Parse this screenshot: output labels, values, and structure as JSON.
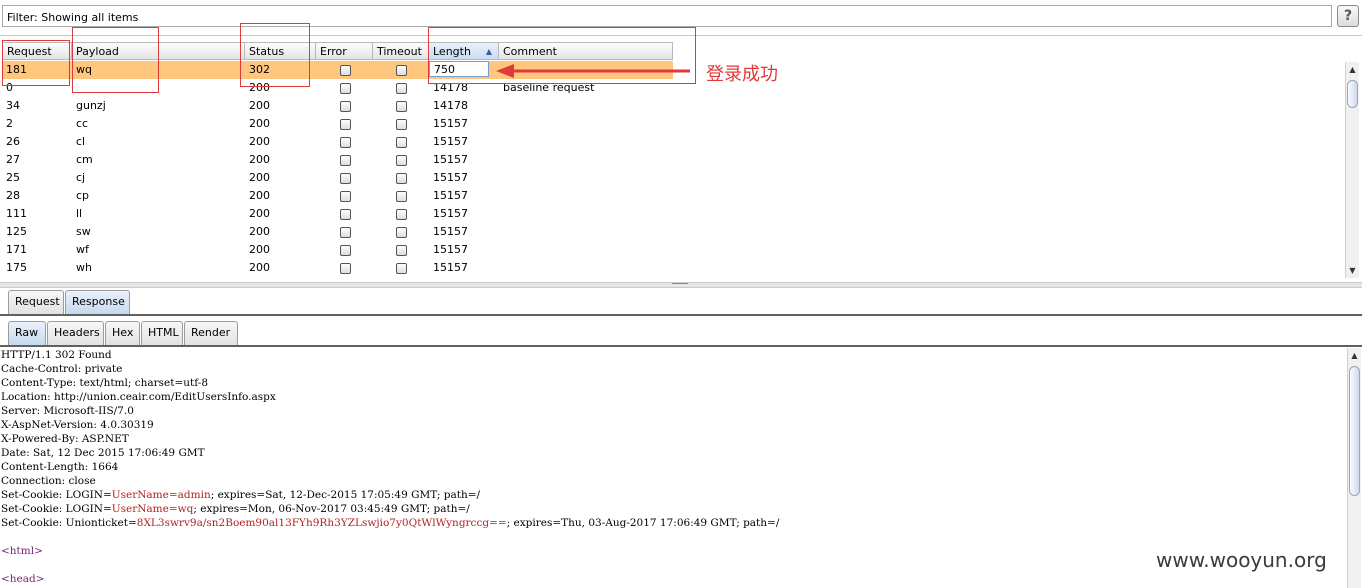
{
  "filter": {
    "text": "Filter: Showing all items",
    "help_label": "?"
  },
  "columns": [
    "Request",
    "Payload",
    "Status",
    "Error",
    "Timeout",
    "Length",
    "Comment"
  ],
  "sorted_column": "Length",
  "rows": [
    {
      "request": "181",
      "payload": "wq",
      "status": "302",
      "error": false,
      "timeout": false,
      "length": "750",
      "comment": "",
      "selected": true
    },
    {
      "request": "0",
      "payload": "",
      "status": "200",
      "error": false,
      "timeout": false,
      "length": "14178",
      "comment": "baseline request"
    },
    {
      "request": "34",
      "payload": "gunzj",
      "status": "200",
      "error": false,
      "timeout": false,
      "length": "14178",
      "comment": ""
    },
    {
      "request": "2",
      "payload": "cc",
      "status": "200",
      "error": false,
      "timeout": false,
      "length": "15157",
      "comment": ""
    },
    {
      "request": "26",
      "payload": "cl",
      "status": "200",
      "error": false,
      "timeout": false,
      "length": "15157",
      "comment": ""
    },
    {
      "request": "27",
      "payload": "cm",
      "status": "200",
      "error": false,
      "timeout": false,
      "length": "15157",
      "comment": ""
    },
    {
      "request": "25",
      "payload": "cj",
      "status": "200",
      "error": false,
      "timeout": false,
      "length": "15157",
      "comment": ""
    },
    {
      "request": "28",
      "payload": "cp",
      "status": "200",
      "error": false,
      "timeout": false,
      "length": "15157",
      "comment": ""
    },
    {
      "request": "111",
      "payload": "ll",
      "status": "200",
      "error": false,
      "timeout": false,
      "length": "15157",
      "comment": ""
    },
    {
      "request": "125",
      "payload": "sw",
      "status": "200",
      "error": false,
      "timeout": false,
      "length": "15157",
      "comment": ""
    },
    {
      "request": "171",
      "payload": "wf",
      "status": "200",
      "error": false,
      "timeout": false,
      "length": "15157",
      "comment": ""
    },
    {
      "request": "175",
      "payload": "wh",
      "status": "200",
      "error": false,
      "timeout": false,
      "length": "15157",
      "comment": ""
    }
  ],
  "annotation": {
    "text": "登录成功"
  },
  "outer_tabs": {
    "items": [
      "Request",
      "Response"
    ],
    "active": "Response"
  },
  "inner_tabs": {
    "items": [
      "Raw",
      "Headers",
      "Hex",
      "HTML",
      "Render"
    ],
    "active": "Raw"
  },
  "response_lines": [
    [
      {
        "t": "HTTP/1.1 302 Found"
      }
    ],
    [
      {
        "t": "Cache-Control: private"
      }
    ],
    [
      {
        "t": "Content-Type: text/html; charset=utf-8"
      }
    ],
    [
      {
        "t": "Location: http://union.ceair.com/EditUsersInfo.aspx"
      }
    ],
    [
      {
        "t": "Server: Microsoft-IIS/7.0"
      }
    ],
    [
      {
        "t": "X-AspNet-Version: 4.0.30319"
      }
    ],
    [
      {
        "t": "X-Powered-By: ASP.NET"
      }
    ],
    [
      {
        "t": "Date: Sat, 12 Dec 2015 17:06:49 GMT"
      }
    ],
    [
      {
        "t": "Content-Length: 1664"
      }
    ],
    [
      {
        "t": "Connection: close"
      }
    ],
    [
      {
        "t": "Set-Cookie: LOGIN="
      },
      {
        "t": "UserName=admin",
        "c": "ck"
      },
      {
        "t": "; expires=Sat, 12-Dec-2015 17:05:49 GMT; path=/"
      }
    ],
    [
      {
        "t": "Set-Cookie: LOGIN="
      },
      {
        "t": "UserName=wq",
        "c": "ck"
      },
      {
        "t": "; expires=Mon, 06-Nov-2017 03:45:49 GMT; path=/"
      }
    ],
    [
      {
        "t": "Set-Cookie: Unionticket="
      },
      {
        "t": "8XL3swrv9a/sn2Boem90al13FYh9Rh3YZLswjio7y0QtWlWyngrccg==",
        "c": "ck"
      },
      {
        "t": "; expires=Thu, 03-Aug-2017 17:06:49 GMT; path=/"
      }
    ],
    [
      {
        "t": ""
      }
    ],
    [
      {
        "t": "<html>",
        "c": "tag"
      }
    ],
    [
      {
        "t": ""
      }
    ],
    [
      {
        "t": "<head>",
        "c": "tag"
      }
    ]
  ],
  "watermark": "www.wooyun.org",
  "icons": {
    "scroll_up": "triangle-up-icon",
    "scroll_down": "triangle-down-icon",
    "sort": "sort-ascending-icon"
  }
}
